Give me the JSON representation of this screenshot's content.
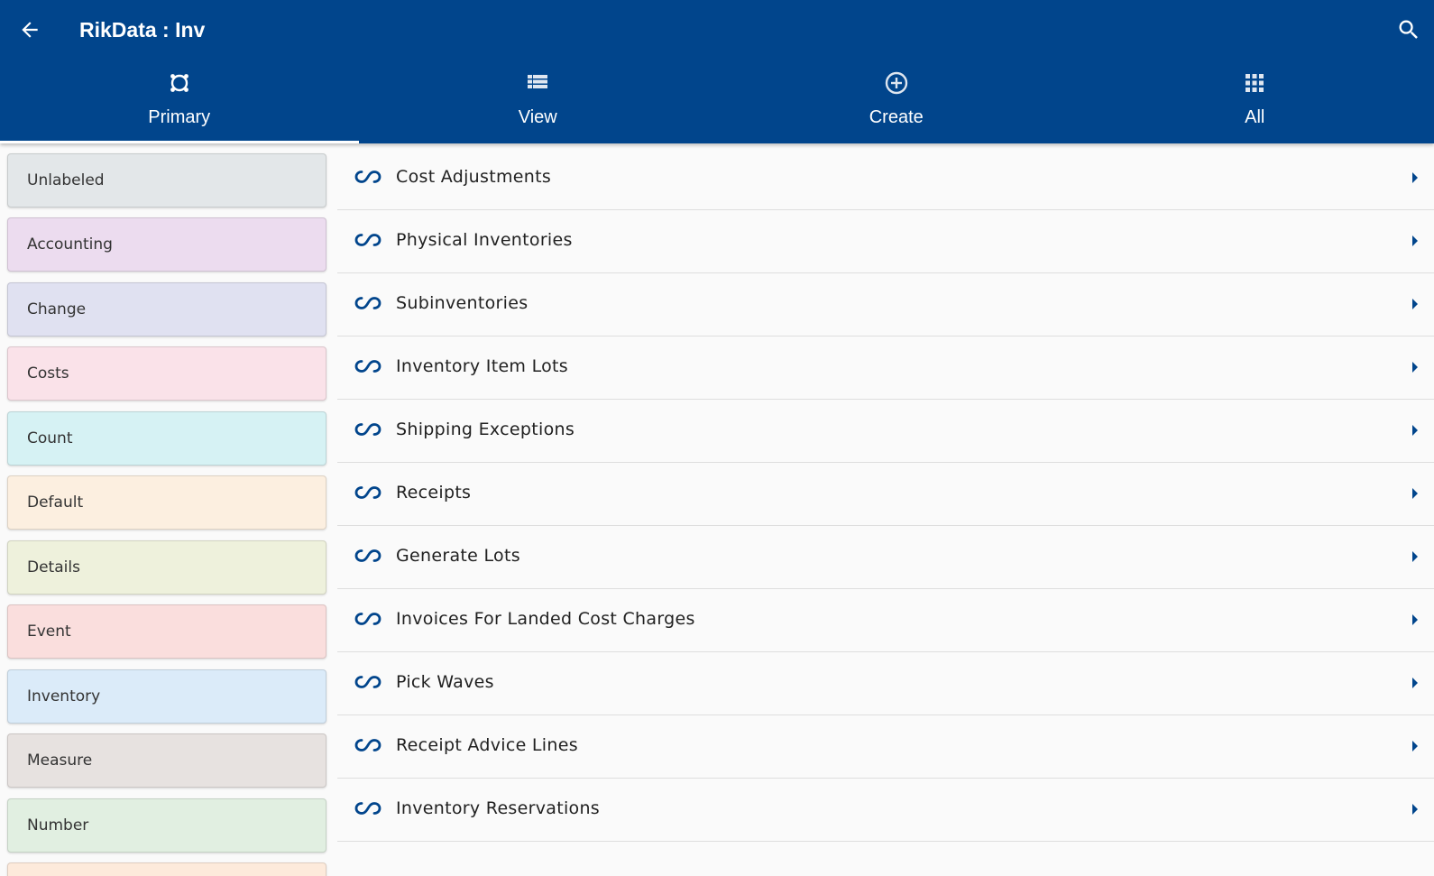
{
  "header": {
    "title": "RikData : Inv",
    "back_icon": "arrow-left-icon",
    "search_icon": "search-icon",
    "background": "#01458c"
  },
  "tabs": [
    {
      "label": "Primary",
      "icon": "primary-icon",
      "active": true
    },
    {
      "label": "View",
      "icon": "list-view-icon",
      "active": false
    },
    {
      "label": "Create",
      "icon": "add-circle-icon",
      "active": false
    },
    {
      "label": "All",
      "icon": "apps-grid-icon",
      "active": false
    }
  ],
  "sidebar": {
    "labels": [
      {
        "label": "Unlabeled",
        "color": "#e3e7e9"
      },
      {
        "label": "Accounting",
        "color": "#ecdcef"
      },
      {
        "label": "Change",
        "color": "#e0e1f1"
      },
      {
        "label": "Costs",
        "color": "#fae2e9"
      },
      {
        "label": "Count",
        "color": "#d6f2f4"
      },
      {
        "label": "Default",
        "color": "#fcefe0"
      },
      {
        "label": "Details",
        "color": "#eef1dc"
      },
      {
        "label": "Event",
        "color": "#fadedd"
      },
      {
        "label": "Inventory",
        "color": "#dbebf9"
      },
      {
        "label": "Measure",
        "color": "#e7e2e0"
      },
      {
        "label": "Number",
        "color": "#e1efe1"
      },
      {
        "label": "",
        "color": "#fdeadb"
      }
    ]
  },
  "list": {
    "item_icon": "link-icon",
    "chevron_icon": "chevron-right-icon",
    "accent": "#01458c",
    "items": [
      {
        "label": "Cost Adjustments"
      },
      {
        "label": "Physical Inventories"
      },
      {
        "label": "Subinventories"
      },
      {
        "label": "Inventory Item Lots"
      },
      {
        "label": "Shipping Exceptions"
      },
      {
        "label": "Receipts"
      },
      {
        "label": "Generate Lots"
      },
      {
        "label": "Invoices For Landed Cost Charges"
      },
      {
        "label": "Pick Waves"
      },
      {
        "label": "Receipt Advice Lines"
      },
      {
        "label": "Inventory Reservations"
      }
    ]
  }
}
